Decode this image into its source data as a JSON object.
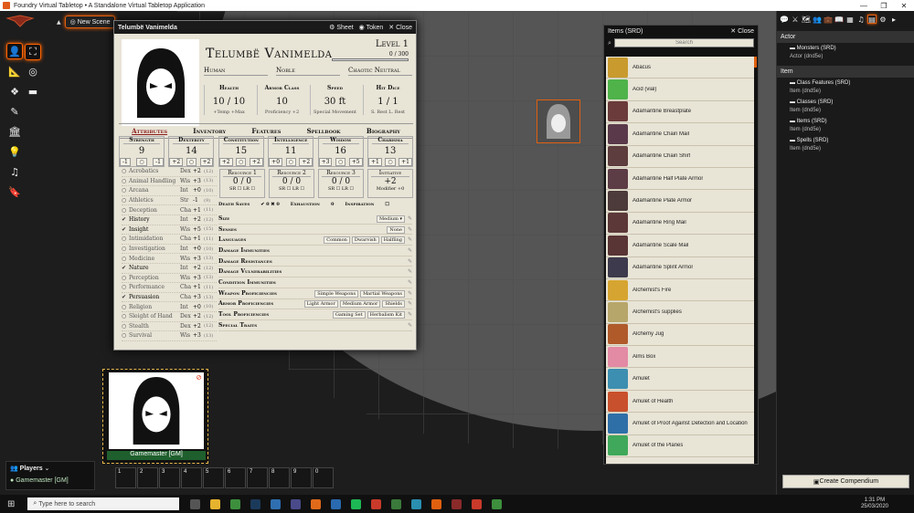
{
  "window": {
    "title": "Foundry Virtual Tabletop • A Standalone Virtual Tabletop Application",
    "controls": [
      "—",
      "❐",
      "✕"
    ]
  },
  "scene_nav": {
    "new_scene": "New Scene"
  },
  "sheet": {
    "title": "Telumbë Vanimelda",
    "buttons": {
      "sheet": "Sheet",
      "token": "Token",
      "close": "Close"
    },
    "name": "Telumbë Vanimelda",
    "level": "Level 1",
    "xp": "0 / 300",
    "race": "Human",
    "background": "Noble",
    "alignment": "Chaotic Neutral",
    "attributes": [
      {
        "label": "Health",
        "value": "10 / 10",
        "sub": "+Temp    +Max"
      },
      {
        "label": "Armor Class",
        "value": "10",
        "sub": "Proficiency +2"
      },
      {
        "label": "Speed",
        "value": "30 ft",
        "sub": "Special Movement"
      },
      {
        "label": "Hit Dice",
        "value": "1 / 1",
        "sub": "S. Rest   L. Rest"
      }
    ],
    "tabs": [
      "Attributes",
      "Inventory",
      "Features",
      "Spellbook",
      "Biography"
    ],
    "abilities": [
      {
        "name": "Strength",
        "score": "9",
        "mod": "-1",
        "save": "-1"
      },
      {
        "name": "Dexterity",
        "score": "14",
        "mod": "+2",
        "save": "+2"
      },
      {
        "name": "Constitution",
        "score": "15",
        "mod": "+2",
        "save": "+2"
      },
      {
        "name": "Intelligence",
        "score": "11",
        "mod": "+0",
        "save": "+2"
      },
      {
        "name": "Wisdom",
        "score": "16",
        "mod": "+3",
        "save": "+5"
      },
      {
        "name": "Charisma",
        "score": "13",
        "mod": "+1",
        "save": "+1"
      }
    ],
    "resources": [
      {
        "name": "Resource 1",
        "value": "0 / 0",
        "foot": "SR ☐   LR ☐"
      },
      {
        "name": "Resource 2",
        "value": "0 / 0",
        "foot": "SR ☐   LR ☐"
      },
      {
        "name": "Resource 3",
        "value": "0 / 0",
        "foot": "SR ☐   LR ☐"
      },
      {
        "name": "Initiative",
        "value": "+2",
        "foot": "Modifier   +0"
      }
    ],
    "death": {
      "label": "Death Saves",
      "val": "✔ 0  ✖ 0",
      "exh": "Exhaustion",
      "exh_val": "0",
      "insp": "Inspiration"
    },
    "skills": [
      {
        "c": "○",
        "n": "Acrobatics",
        "a": "Dex",
        "m": "+2",
        "p": "(12)"
      },
      {
        "c": "○",
        "n": "Animal Handling",
        "a": "Wis",
        "m": "+3",
        "p": "(13)"
      },
      {
        "c": "○",
        "n": "Arcana",
        "a": "Int",
        "m": "+0",
        "p": "(10)"
      },
      {
        "c": "○",
        "n": "Athletics",
        "a": "Str",
        "m": "-1",
        "p": "(9)"
      },
      {
        "c": "○",
        "n": "Deception",
        "a": "Cha",
        "m": "+1",
        "p": "(11)"
      },
      {
        "c": "✔",
        "n": "History",
        "a": "Int",
        "m": "+2",
        "p": "(12)"
      },
      {
        "c": "✔",
        "n": "Insight",
        "a": "Wis",
        "m": "+5",
        "p": "(15)"
      },
      {
        "c": "○",
        "n": "Intimidation",
        "a": "Cha",
        "m": "+1",
        "p": "(11)"
      },
      {
        "c": "○",
        "n": "Investigation",
        "a": "Int",
        "m": "+0",
        "p": "(10)"
      },
      {
        "c": "○",
        "n": "Medicine",
        "a": "Wis",
        "m": "+3",
        "p": "(13)"
      },
      {
        "c": "✔",
        "n": "Nature",
        "a": "Int",
        "m": "+2",
        "p": "(12)"
      },
      {
        "c": "○",
        "n": "Perception",
        "a": "Wis",
        "m": "+3",
        "p": "(13)"
      },
      {
        "c": "○",
        "n": "Performance",
        "a": "Cha",
        "m": "+1",
        "p": "(11)"
      },
      {
        "c": "✔",
        "n": "Persuasion",
        "a": "Cha",
        "m": "+3",
        "p": "(13)"
      },
      {
        "c": "○",
        "n": "Religion",
        "a": "Int",
        "m": "+0",
        "p": "(10)"
      },
      {
        "c": "○",
        "n": "Sleight of Hand",
        "a": "Dex",
        "m": "+2",
        "p": "(12)"
      },
      {
        "c": "○",
        "n": "Stealth",
        "a": "Dex",
        "m": "+2",
        "p": "(12)"
      },
      {
        "c": "○",
        "n": "Survival",
        "a": "Wis",
        "m": "+3",
        "p": "(13)"
      }
    ],
    "traits": [
      {
        "label": "Size",
        "tags": [
          "Medium ▾"
        ]
      },
      {
        "label": "Senses",
        "tags": [
          "None"
        ]
      },
      {
        "label": "Languages",
        "tags": [
          "Common",
          "Dwarvish",
          "Halfling"
        ]
      },
      {
        "label": "Damage Immunities",
        "tags": []
      },
      {
        "label": "Damage Resistances",
        "tags": []
      },
      {
        "label": "Damage Vulnerabilities",
        "tags": []
      },
      {
        "label": "Condition Immunities",
        "tags": []
      },
      {
        "label": "Weapon Proficiencies",
        "tags": [
          "Simple Weapons",
          "Martial Weapons"
        ]
      },
      {
        "label": "Armor Proficiencies",
        "tags": [
          "Light Armor",
          "Medium Armor",
          "Shields"
        ]
      },
      {
        "label": "Tool Proficiencies",
        "tags": [
          "Gaming Set",
          "Herbalism Kit"
        ]
      },
      {
        "label": "Special Traits",
        "tags": []
      }
    ]
  },
  "items_window": {
    "title": "Items (SRD)",
    "close": "Close",
    "search_placeholder": "Search",
    "items": [
      {
        "name": "Abacus",
        "color": "#c99a2e"
      },
      {
        "name": "Acid (vial)",
        "color": "#4fb34a"
      },
      {
        "name": "Adamantine Breastplate",
        "color": "#6b3b3b"
      },
      {
        "name": "Adamantine Chain Mail",
        "color": "#5a3a4a"
      },
      {
        "name": "Adamantine Chain Shirt",
        "color": "#5d3d3d"
      },
      {
        "name": "Adamantine Half Plate Armor",
        "color": "#5c3c45"
      },
      {
        "name": "Adamantine Plate Armor",
        "color": "#4d3a3a"
      },
      {
        "name": "Adamantine Ring Mail",
        "color": "#5c3838"
      },
      {
        "name": "Adamantine Scale Mail",
        "color": "#593535"
      },
      {
        "name": "Adamantine Splint Armor",
        "color": "#3d3a4d"
      },
      {
        "name": "Alchemist's Fire",
        "color": "#d6a531"
      },
      {
        "name": "Alchemist's supplies",
        "color": "#b7a66a"
      },
      {
        "name": "Alchemy Jug",
        "color": "#b05a2a"
      },
      {
        "name": "Alms Box",
        "color": "#e38aa5"
      },
      {
        "name": "Amulet",
        "color": "#3c8fb0"
      },
      {
        "name": "Amulet of Health",
        "color": "#c9502c"
      },
      {
        "name": "Amulet of Proof Against Detection and Location",
        "color": "#2f6fa8"
      },
      {
        "name": "Amulet of the Planes",
        "color": "#3fa85a"
      }
    ]
  },
  "sidebar": {
    "sections": [
      {
        "title": "Actor",
        "packs": [
          {
            "name": "Monsters (SRD)",
            "sub": "Actor (dnd5e)"
          }
        ]
      },
      {
        "title": "Item",
        "packs": [
          {
            "name": "Class Features (SRD)",
            "sub": "Item (dnd5e)"
          },
          {
            "name": "Classes (SRD)",
            "sub": "Item (dnd5e)"
          },
          {
            "name": "Items (SRD)",
            "sub": "Item (dnd5e)"
          },
          {
            "name": "Spells (SRD)",
            "sub": "Item (dnd5e)"
          }
        ]
      }
    ],
    "create": "Create Compendium"
  },
  "gm": {
    "name": "Gamemaster [GM]"
  },
  "players": {
    "title": "Players",
    "player": "Gamemaster [GM]"
  },
  "hotbar": {
    "slots": [
      "1",
      "2",
      "3",
      "4",
      "5",
      "6",
      "7",
      "8",
      "9",
      "0"
    ]
  },
  "taskbar": {
    "search": "Type here to search",
    "time": "1:31 PM",
    "date": "25/03/2020"
  }
}
